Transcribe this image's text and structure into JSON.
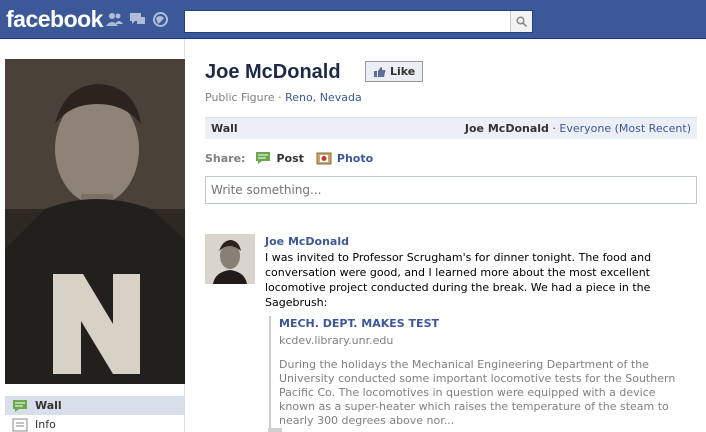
{
  "topbar": {
    "logo": "facebook",
    "search": {
      "value": "",
      "placeholder": ""
    },
    "icons": [
      "friends-icon",
      "messages-icon",
      "notifications-icon",
      "search-icon"
    ]
  },
  "sidebar": {
    "items": [
      {
        "label": "Wall",
        "icon": "wall-icon",
        "active": true
      },
      {
        "label": "Info",
        "icon": "info-icon",
        "active": false
      }
    ]
  },
  "profile": {
    "name": "Joe McDonald",
    "like_label": "Like",
    "category": "Public Figure",
    "location": "Reno, Nevada"
  },
  "wall": {
    "tab_label": "Wall",
    "owner": "Joe McDonald",
    "filter": "Everyone (Most Recent)"
  },
  "share": {
    "label": "Share:",
    "post_label": "Post",
    "photo_label": "Photo",
    "composer_placeholder": "Write something..."
  },
  "post": {
    "author": "Joe McDonald",
    "text": "I was invited to Professor Scrugham's for dinner tonight. The food and conversation were good, and I learned more about the most excellent locomotive project conducted during the break. We had a piece in the Sagebrush:",
    "attachment": {
      "title": "MECH. DEPT. MAKES TEST",
      "domain": "kcdev.library.unr.edu",
      "description": "During the holidays the Mechanical Engineering Department of the University conducted some important locomotive tests for the Southern Pacific Co. The locomotives in question were equipped with a device known as a super-heater which raises the temperature of the steam to nearly 300 degrees above nor..."
    }
  },
  "colors": {
    "brand": "#3b5998",
    "link": "#3b5998",
    "muted": "#808080",
    "wall_bar": "#eceff5"
  }
}
